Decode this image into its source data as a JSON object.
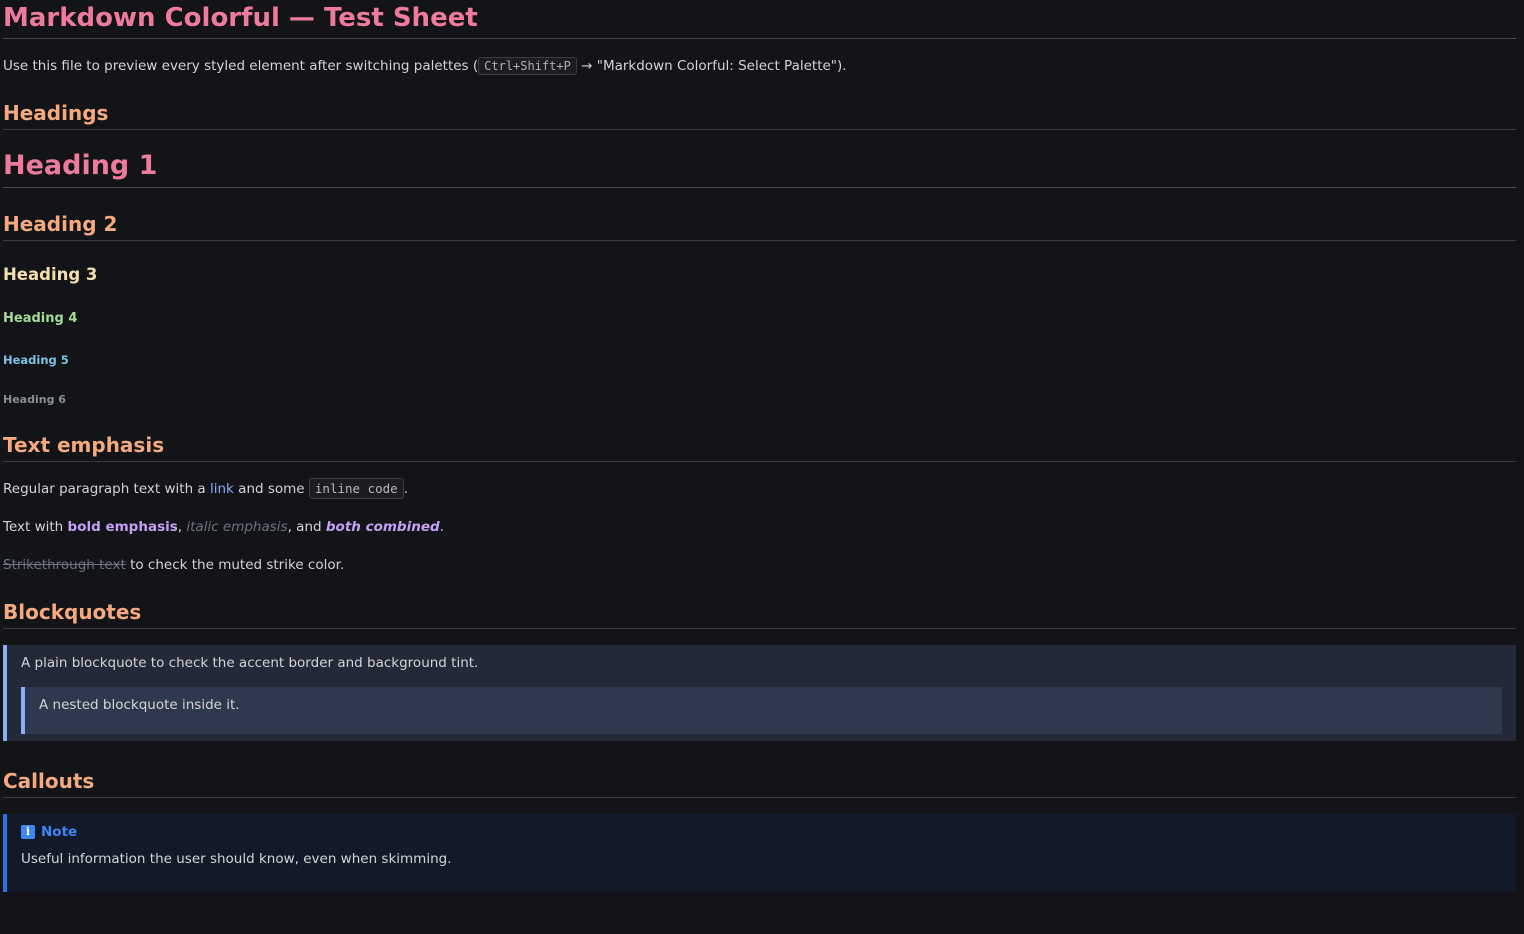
{
  "title": "Markdown Colorful — Test Sheet",
  "intro": {
    "before": "Use this file to preview every styled element after switching palettes (",
    "shortcut": "Ctrl+Shift+P",
    "after": " → \"Markdown Colorful: Select Palette\")."
  },
  "sections": {
    "headings": "Headings",
    "emphasis": "Text emphasis",
    "blockquotes": "Blockquotes",
    "callouts": "Callouts"
  },
  "demo_headings": {
    "h1": "Heading 1",
    "h2": "Heading 2",
    "h3": "Heading 3",
    "h4": "Heading 4",
    "h5": "Heading 5",
    "h6": "Heading 6"
  },
  "emphasis": {
    "p1_before": "Regular paragraph text with a ",
    "link": "link",
    "p1_mid": " and some ",
    "inline_code": "inline code",
    "p1_after": ".",
    "p2_before": "Text with ",
    "bold": "bold emphasis",
    "comma1": ", ",
    "italic": "italic emphasis",
    "and": ", and ",
    "both": "both combined",
    "p2_after": ".",
    "strike": "Strikethrough text",
    "p3_after": " to check the muted strike color."
  },
  "blockquotes": {
    "plain": "A plain blockquote to check the accent border and background tint.",
    "nested": "A nested blockquote inside it."
  },
  "callout": {
    "icon": "info-icon",
    "title": "Note",
    "body": "Useful information the user should know, even when skimming."
  },
  "colors": {
    "background": "#131417",
    "h1": "#ee7b9b",
    "h2": "#f5a97f",
    "h3": "#f7dfb0",
    "h4": "#a6da95",
    "h5": "#7dc4e4",
    "h6": "#8a8d96",
    "link": "#8aadf4",
    "bold": "#c6a0f6",
    "callout_accent": "#3d86f5"
  }
}
